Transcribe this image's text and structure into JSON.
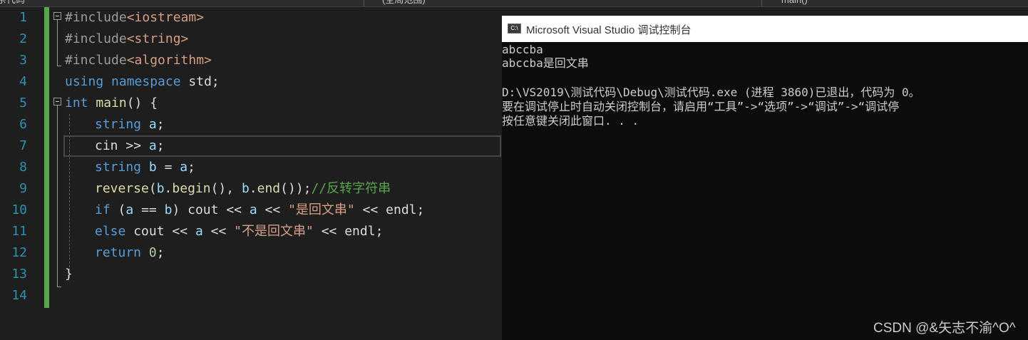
{
  "topbar": {
    "left": "杂代码",
    "middle": "(全局范围)",
    "right": "main()"
  },
  "editor": {
    "line_numbers": [
      "1",
      "2",
      "3",
      "4",
      "5",
      "6",
      "7",
      "8",
      "9",
      "10",
      "11",
      "12",
      "13",
      "14"
    ],
    "lines": {
      "l1_pp": "#include",
      "l1_str": "<iostream>",
      "l2_pp": "#include",
      "l2_str": "<string>",
      "l3_pp": "#include",
      "l3_str": "<algorithm>",
      "l4_kw1": "using",
      "l4_kw2": "namespace",
      "l4_rest": "std;",
      "l5_kw": "int",
      "l5_fn": "main",
      "l5_rest": "() {",
      "l6_type": "string",
      "l6_var": "a",
      "l6_end": ";",
      "l7_var1": "cin",
      "l7_op": ">>",
      "l7_var2": "a",
      "l7_end": ";",
      "l8_type": "string",
      "l8_var1": "b",
      "l8_op": "=",
      "l8_var2": "a",
      "l8_end": ";",
      "l9_fn": "reverse",
      "l9_p1": "(",
      "l9_b1": "b",
      "l9_dot1": ".",
      "l9_begin": "begin",
      "l9_p2": "(), ",
      "l9_b2": "b",
      "l9_dot2": ".",
      "l9_end": "end",
      "l9_p3": "());",
      "l9_comment": "//反转字符串",
      "l10_kw": "if",
      "l10_p1": "(",
      "l10_a": "a",
      "l10_eq": "==",
      "l10_b": "b",
      "l10_p2": ")",
      "l10_cout": "cout",
      "l10_op1": "<<",
      "l10_a2": "a",
      "l10_op2": "<<",
      "l10_str": "\"是回文串\"",
      "l10_op3": "<<",
      "l10_endl": "endl;",
      "l11_kw": "else",
      "l11_cout": "cout",
      "l11_op1": "<<",
      "l11_a": "a",
      "l11_op2": "<<",
      "l11_str": "\"不是回文串\"",
      "l11_op3": "<<",
      "l11_endl": "endl;",
      "l12_kw": "return",
      "l12_num": "0",
      "l12_end": ";",
      "l13_brace": "}"
    }
  },
  "console": {
    "icon_text": "C:\\",
    "title": "Microsoft Visual Studio 调试控制台",
    "lines": [
      "abccba",
      "abccba是回文串",
      "",
      "D:\\VS2019\\测试代码\\Debug\\测试代码.exe (进程 3860)已退出，代码为 0。",
      "要在调试停止时自动关闭控制台，请启用“工具”->“选项”->“调试”->“调试停",
      "按任意键关闭此窗口. . ."
    ]
  },
  "watermark": "CSDN @&矢志不渝^O^",
  "colors": {
    "editor_bg": "#1e1e1e",
    "console_bg": "#0c0c0c",
    "change_bar": "#57a64a",
    "line_number": "#2b91af",
    "keyword": "#569cd6",
    "string": "#d69d85",
    "comment": "#57a64a"
  }
}
